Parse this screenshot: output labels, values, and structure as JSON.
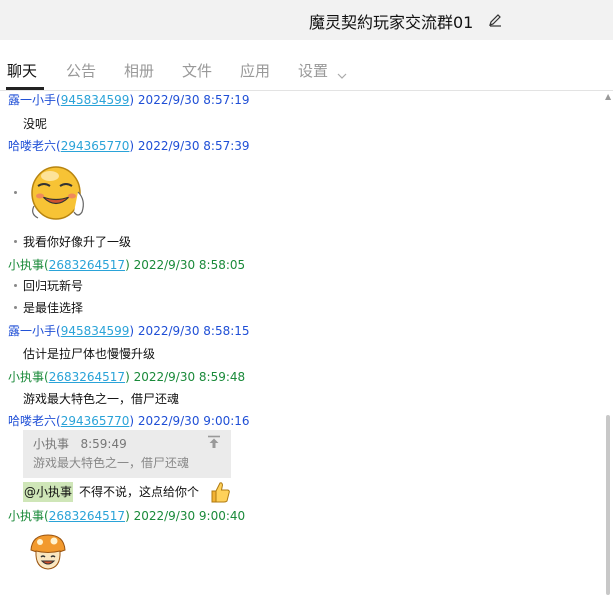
{
  "window": {
    "title": "魔灵契約玩家交流群01"
  },
  "tabs": [
    {
      "label": "聊天",
      "active": true
    },
    {
      "label": "公告"
    },
    {
      "label": "相册"
    },
    {
      "label": "文件"
    },
    {
      "label": "应用"
    },
    {
      "label": "设置"
    }
  ],
  "colors": {
    "name_blue": "#1f4fd6",
    "name_green": "#1a8a3a",
    "uin_link": "#2aa3d8",
    "mention_bg": "#cfe6b8"
  },
  "messages": [
    {
      "sender": "露一小手",
      "uin": "945834599",
      "time": "2022/9/30 8:57:19",
      "lines": [
        "没呢"
      ]
    },
    {
      "sender": "哈喽老六",
      "uin": "294365770",
      "time": "2022/9/30 8:57:39",
      "lines": [
        "我看你好像升了一级"
      ],
      "sticker": "laughing-face-sticker"
    },
    {
      "sender": "小执事",
      "uin": "2683264517",
      "time": "2022/9/30 8:58:05",
      "lines": [
        "回归玩新号",
        "是最佳选择"
      ]
    },
    {
      "sender": "露一小手",
      "uin": "945834599",
      "time": "2022/9/30 8:58:15",
      "lines": [
        "估计是拉尸体也慢慢升级"
      ]
    },
    {
      "sender": "小执事",
      "uin": "2683264517",
      "time": "2022/9/30 8:59:48",
      "lines": [
        "游戏最大特色之一，借尸还魂"
      ]
    },
    {
      "sender": "哈喽老六",
      "uin": "294365770",
      "time": "2022/9/30 9:00:16",
      "quote": {
        "sender": "小执事",
        "time": "8:59:49",
        "text": "游戏最大特色之一，借尸还魂"
      },
      "mention": "@小执事",
      "lines": [
        "不得不说，这点给你个"
      ],
      "emoji": "thumbs-up"
    },
    {
      "sender": "小执事",
      "uin": "2683264517",
      "time": "2022/9/30 9:00:40",
      "sticker": "mushroom-sticker"
    }
  ]
}
